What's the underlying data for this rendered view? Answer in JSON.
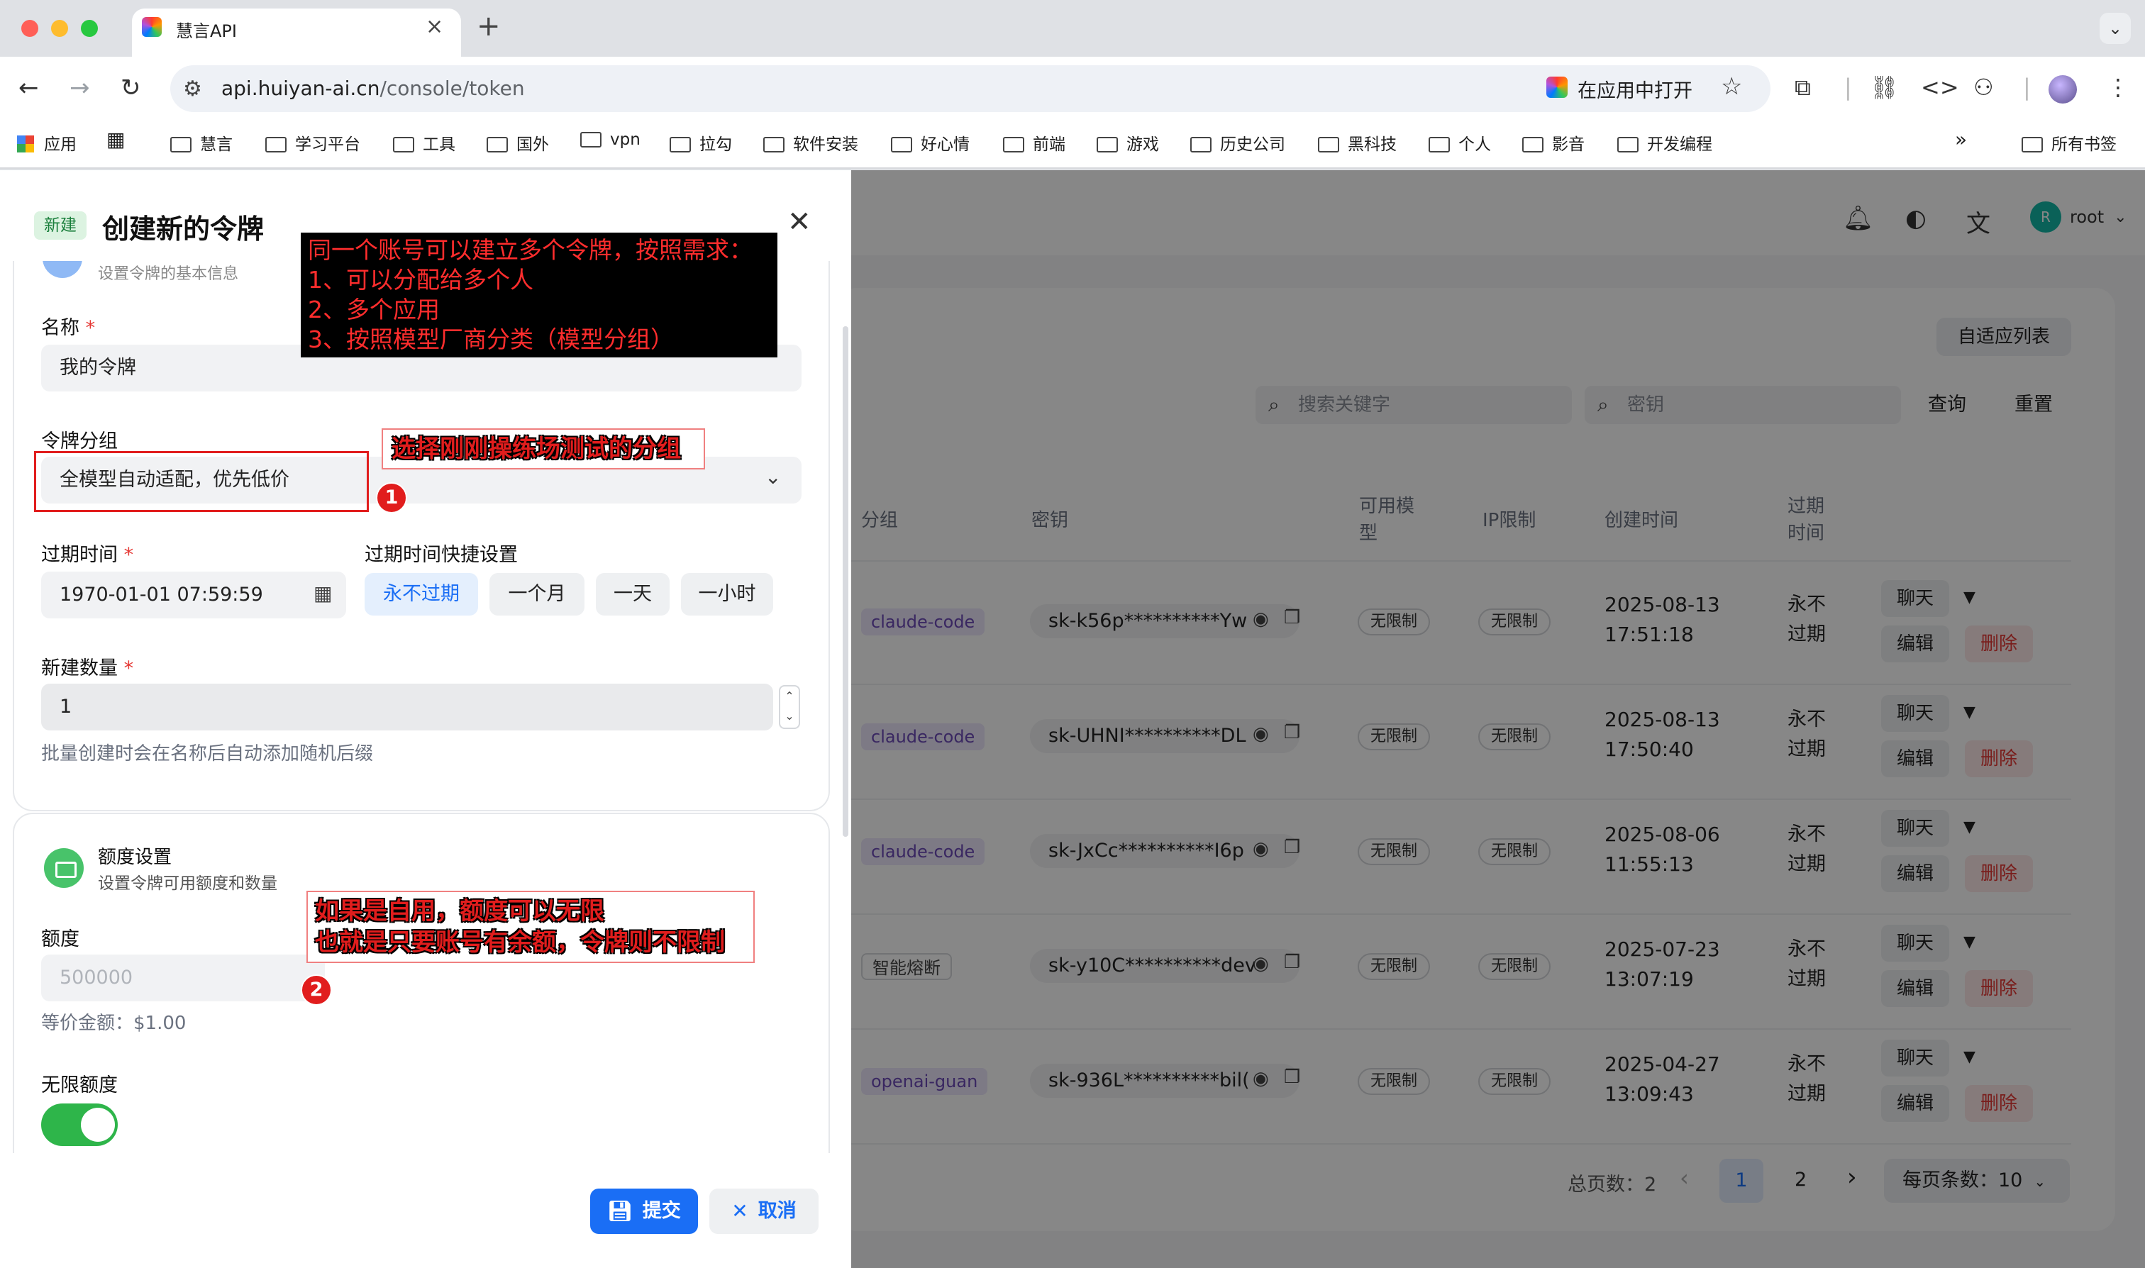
{
  "browser": {
    "tab_title": "慧言API",
    "url_host": "api.huiyan-ai.cn",
    "url_path": "/console/token",
    "open_in_app": "在应用中打开",
    "bookmarks": [
      "应用",
      "慧言",
      "学习平台",
      "工具",
      "国外",
      "vpn",
      "拉勾",
      "软件安装",
      "好心情",
      "前端",
      "游戏",
      "历史公司",
      "黑科技",
      "个人",
      "影音",
      "开发编程"
    ],
    "overflow": "»",
    "all_bookmarks": "所有书签"
  },
  "header": {
    "user_initial": "R",
    "user_name": "root"
  },
  "list": {
    "adaptive_label": "自适应列表",
    "search_placeholder": "搜索关键字",
    "key_placeholder": "密钥",
    "query_label": "查询",
    "reset_label": "重置",
    "columns": {
      "group": "分组",
      "key": "密钥",
      "models": "可用模型",
      "ip": "IP限制",
      "created": "创建时间",
      "expire": "过期时间"
    },
    "rows": [
      {
        "group": "claude-code",
        "key": "sk-k56p**********Yw",
        "models": "无限制",
        "ip": "无限制",
        "date": "2025-08-13",
        "time": "17:51:18",
        "expire1": "永不",
        "expire2": "过期"
      },
      {
        "group": "claude-code",
        "key": "sk-UHNI**********DL",
        "models": "无限制",
        "ip": "无限制",
        "date": "2025-08-13",
        "time": "17:50:40",
        "expire1": "永不",
        "expire2": "过期"
      },
      {
        "group": "claude-code",
        "key": "sk-JxCc**********I6p",
        "models": "无限制",
        "ip": "无限制",
        "date": "2025-08-06",
        "time": "11:55:13",
        "expire1": "永不",
        "expire2": "过期"
      },
      {
        "group": "智能熔断",
        "key": "sk-y10C**********dev",
        "models": "无限制",
        "ip": "无限制",
        "date": "2025-07-23",
        "time": "13:07:19",
        "expire1": "永不",
        "expire2": "过期"
      },
      {
        "group": "openai-guan",
        "key": "sk-936L**********bil(",
        "models": "无限制",
        "ip": "无限制",
        "date": "2025-04-27",
        "time": "13:09:43",
        "expire1": "永不",
        "expire2": "过期"
      }
    ],
    "actions": {
      "chat": "聊天",
      "edit": "编辑",
      "delete": "删除"
    },
    "pager": {
      "total_label": "总页数：",
      "total": "2",
      "page1": "1",
      "page2": "2",
      "per_page": "每页条数：10"
    }
  },
  "sheet": {
    "badge": "新建",
    "title": "创建新的令牌",
    "section1_subtitle": "设置令牌的基本信息",
    "name_label": "名称",
    "name_value": "我的令牌",
    "group_label": "令牌分组",
    "group_value": "全模型自动适配，优先低价",
    "expire_label": "过期时间",
    "expire_value": "1970-01-01 07:59:59",
    "quick_label": "过期时间快捷设置",
    "quick": [
      "永不过期",
      "一个月",
      "一天",
      "一小时"
    ],
    "count_label": "新建数量",
    "count_value": "1",
    "count_helper": "批量创建时会在名称后自动添加随机后缀",
    "section2_title": "额度设置",
    "section2_subtitle": "设置令牌可用额度和数量",
    "quota_label": "额度",
    "quota_placeholder": "500000",
    "quota_helper": "等价金额：$1.00",
    "unlimited_label": "无限额度",
    "unlimited_on": true,
    "submit": "提交",
    "cancel": "取消"
  },
  "annotations": {
    "note1": [
      "同一个账号可以建立多个令牌，按照需求：",
      "1、可以分配给多个人",
      "2、多个应用",
      "3、按照模型厂商分类（模型分组）"
    ],
    "note2": "选择刚刚操练场测试的分组",
    "note3": [
      "如果是自用，额度可以无限",
      "也就是只要账号有余额，令牌则不限制"
    ],
    "badge1": "1",
    "badge2": "2"
  },
  "colors": {
    "accent": "#1a6ef5",
    "toggle_on": "#2eb54a",
    "annotation_red": "#e11d1d",
    "danger": "#e53935"
  }
}
